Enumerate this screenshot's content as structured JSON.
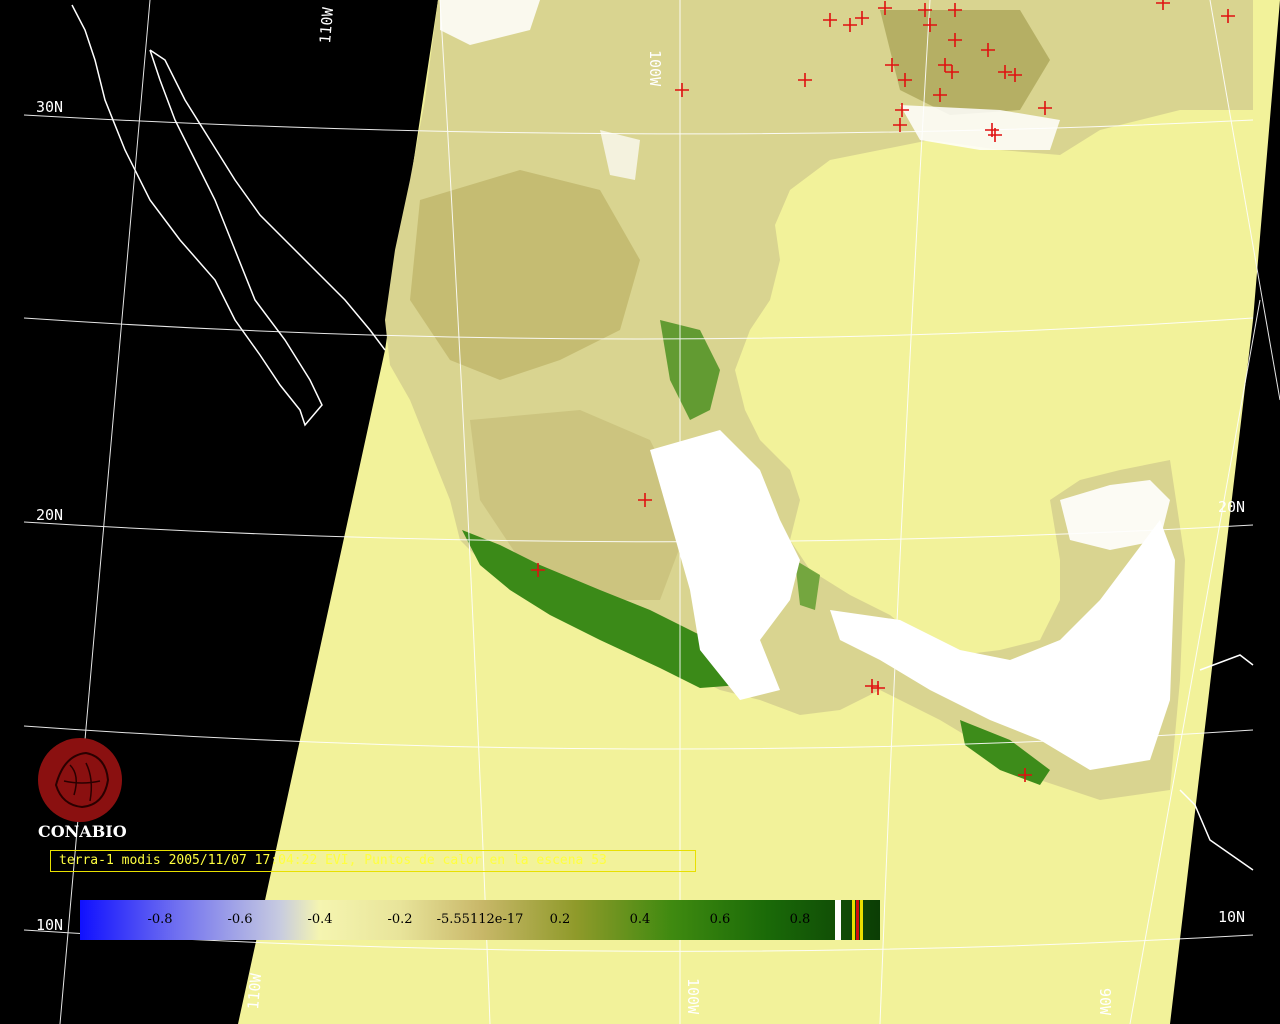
{
  "map": {
    "grid_labels": {
      "lat_30": "30N",
      "lat_20_left": "20N",
      "lat_20_right": "20N",
      "lat_10_left": "10N",
      "lat_10_right": "10N",
      "lon_110_top": "110W",
      "lon_100_top": "100W",
      "lon_110_bottom": "110W",
      "lon_100_bottom": "100W",
      "lon_90_bottom": "90W"
    },
    "colors": {
      "background": "#000000",
      "ocean_swath": "#f2f29a",
      "cloud": "#ffffff",
      "vegetation_high": "#2f7a12",
      "hotspot_marker": "#e01010",
      "gridline": "#ffffff"
    },
    "hotspot_count_shown": 53
  },
  "caption": {
    "text": "terra-1 modis 2005/11/07 17:04:22 EVI, Puntos de calor en la escena 53"
  },
  "logo": {
    "name": "CONABIO"
  },
  "colorbar": {
    "ticks": [
      "-0.8",
      "-0.6",
      "-0.4",
      "-0.2",
      "-5.55112e-17",
      "0.2",
      "0.4",
      "0.6",
      "0.8"
    ],
    "colors": {
      "low": "#1010ff",
      "mid": "#f5f5b0",
      "high": "#0b3d05",
      "extra_white": "#ffffff",
      "extra_yellow": "#e8e000",
      "extra_red": "#d01010"
    }
  }
}
